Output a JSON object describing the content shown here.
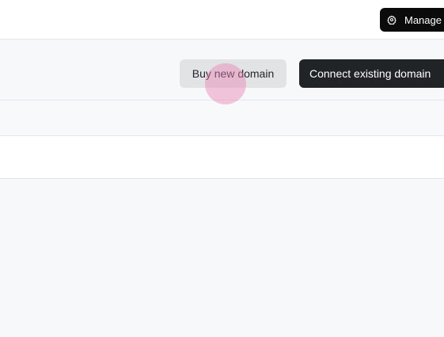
{
  "header": {
    "manage_label": "Manage",
    "manage_icon": "gear-icon"
  },
  "actions": {
    "buy_label": "Buy new domain",
    "connect_label": "Connect existing domain"
  },
  "domains_table": {
    "rows": []
  },
  "colors": {
    "primary_dark": "#212427",
    "secondary_bg": "#e2e3e5",
    "page_bg": "#f7f8fa"
  }
}
